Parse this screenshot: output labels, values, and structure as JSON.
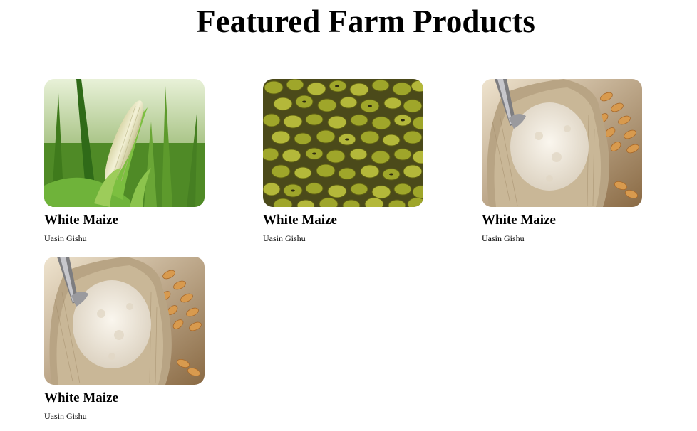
{
  "page": {
    "title": "Featured Farm Products"
  },
  "products": [
    {
      "name": "White Maize",
      "location": "Uasin Gishu",
      "image": "maize-cob-image"
    },
    {
      "name": "White Maize",
      "location": "Uasin Gishu",
      "image": "green-beans-image"
    },
    {
      "name": "White Maize",
      "location": "Uasin Gishu",
      "image": "flour-sack-image"
    },
    {
      "name": "White Maize",
      "location": "Uasin Gishu",
      "image": "flour-sack-image"
    }
  ]
}
